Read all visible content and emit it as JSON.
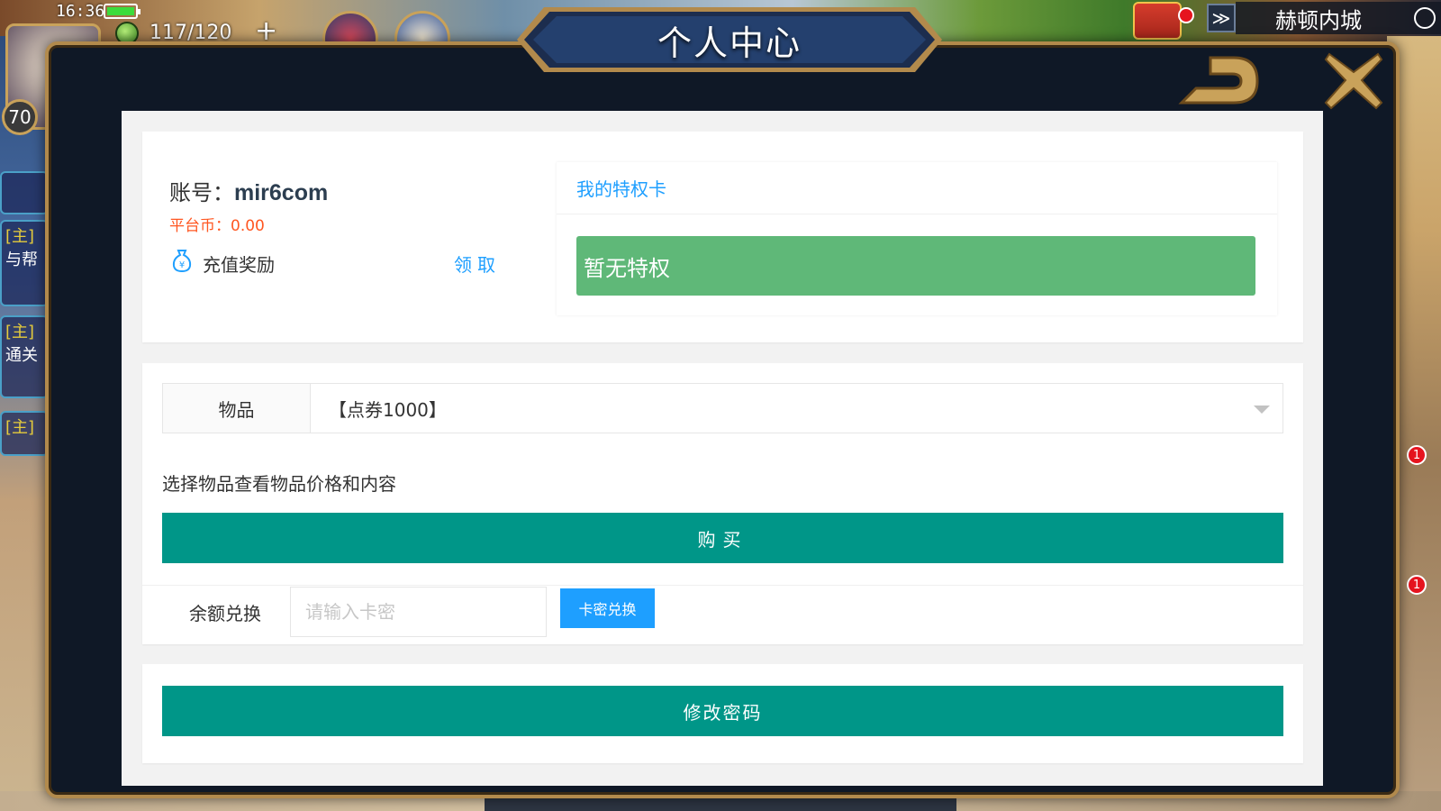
{
  "status_bar": {
    "time": "16:36",
    "energy": "117/120",
    "level": "70"
  },
  "hud": {
    "location": "赫顿内城",
    "side_tasks": [
      {
        "tag": "[主]",
        "text": "与帮"
      },
      {
        "tag": "[主]",
        "text": "通关"
      },
      {
        "tag": "[主]",
        "text": ""
      }
    ],
    "notification_count": "1"
  },
  "dialog": {
    "title": "个人中心"
  },
  "account": {
    "label": "账号：",
    "name": "mir6com",
    "platform_coin": "平台币：0.00",
    "reward_label": "充值奖励",
    "claim_label": "领取"
  },
  "privilege": {
    "header": "我的特权卡",
    "status": "暂无特权"
  },
  "shop": {
    "item_label": "物品",
    "selected_item": "【点券1000】",
    "hint": "选择物品查看物品价格和内容",
    "buy_label": "购买",
    "redeem_label": "余额兑换",
    "input_placeholder": "请输入卡密",
    "input_value": "",
    "redeem_button_label": "卡密兑换"
  },
  "security": {
    "change_password_label": "修改密码"
  },
  "colors": {
    "primary_green": "#009688",
    "privilege_green": "#5fb878",
    "link_blue": "#1e9fff",
    "coin_orange": "#ff5722",
    "frame_gold": "#b28a4c",
    "frame_dark": "#0f1826"
  }
}
